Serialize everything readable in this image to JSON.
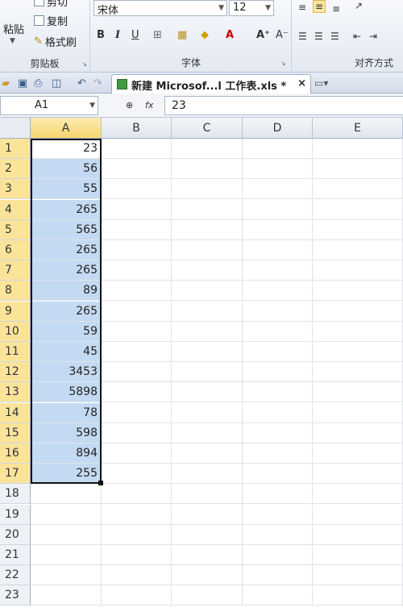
{
  "ribbon": {
    "clipboard": {
      "paste_label": "粘贴",
      "cut_label": "剪切",
      "copy_label": "复制",
      "format_painter_label": "格式刷",
      "group_label": "剪贴板"
    },
    "font": {
      "font_name": "宋体",
      "font_size": "12",
      "bold": "B",
      "italic": "I",
      "underline": "U",
      "grow": "A⁺",
      "shrink": "A⁻",
      "group_label": "字体"
    },
    "alignment": {
      "group_label": "对齐方式"
    }
  },
  "tabs": {
    "active_doc": "新建 Microsof...l 工作表.xls *",
    "close": "×"
  },
  "formula_bar": {
    "name_box": "A1",
    "fx": "fx",
    "value": "23"
  },
  "sheet": {
    "columns": [
      "A",
      "B",
      "C",
      "D",
      "E"
    ],
    "rows": [
      "1",
      "2",
      "3",
      "4",
      "5",
      "6",
      "7",
      "8",
      "9",
      "10",
      "11",
      "12",
      "13",
      "14",
      "15",
      "16",
      "17",
      "18",
      "19",
      "20",
      "21",
      "22",
      "23"
    ],
    "column_a_values": [
      "23",
      "56",
      "55",
      "265",
      "565",
      "265",
      "265",
      "89",
      "265",
      "59",
      "45",
      "3453",
      "5898",
      "78",
      "598",
      "894",
      "255"
    ]
  },
  "colors": {
    "selection_fill": "#c4daf2",
    "header_highlight": "#fbe49a",
    "doc_icon": "#3f9a3f"
  }
}
